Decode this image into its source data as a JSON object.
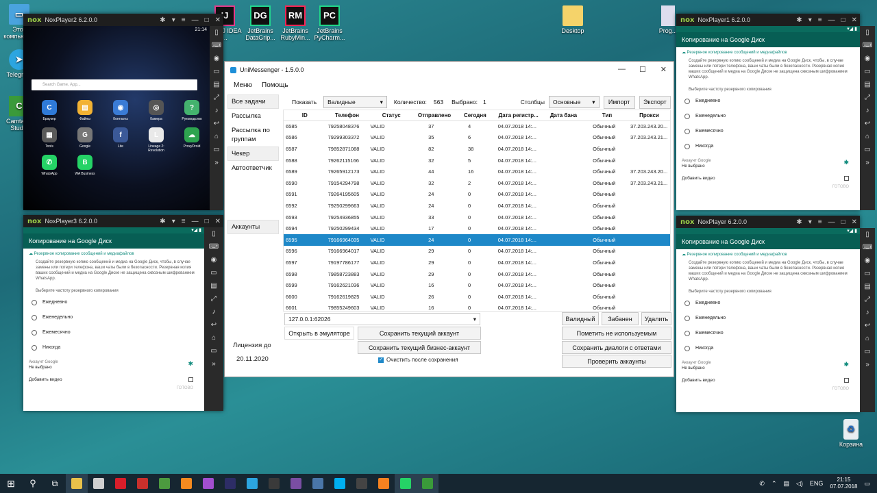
{
  "desktop": {
    "icons_top": [
      {
        "label": "IntelliJ IDEA ...",
        "abbr": "IJ",
        "color": "#111111"
      },
      {
        "label": "JetBrains DataGrip...",
        "abbr": "DG",
        "color": "#111111"
      },
      {
        "label": "JetBrains RubyMin...",
        "abbr": "RM",
        "color": "#111111"
      },
      {
        "label": "JetBrains PyCharm...",
        "abbr": "PC",
        "color": "#111111"
      }
    ],
    "left_icons": [
      {
        "label": "Этот компьютер"
      },
      {
        "label": "Telegram"
      },
      {
        "label": "Camtasia Studio"
      }
    ],
    "desktop_folder": "Desktop",
    "recycle_bin": "Корзина",
    "prog_icon": "Prog..."
  },
  "nox2": {
    "title": "NoxPlayer2 6.2.0.0",
    "time": "21:14",
    "search_placeholder": "Search Game, App...",
    "apps": [
      {
        "label": "Браузер",
        "color": "#2f7ad8",
        "glyph": "C"
      },
      {
        "label": "Файлы",
        "color": "#f2b233",
        "glyph": "▤"
      },
      {
        "label": "Контакты",
        "color": "#3a7bd5",
        "glyph": "◉"
      },
      {
        "label": "Камера",
        "color": "#555555",
        "glyph": "◎"
      },
      {
        "label": "Руководство",
        "color": "#44b26e",
        "glyph": "?"
      },
      {
        "label": "Tools",
        "color": "#5a5a5a",
        "glyph": "▦"
      },
      {
        "label": "Google",
        "color": "#777777",
        "glyph": "G"
      },
      {
        "label": "Lite",
        "color": "#3b5998",
        "glyph": "f"
      },
      {
        "label": "Lineage 2: Revolution",
        "color": "#e9e9e9",
        "glyph": "L"
      },
      {
        "label": "ProxyDroid",
        "color": "#2ea44f",
        "glyph": "☁"
      },
      {
        "label": "WhatsApp",
        "color": "#25d366",
        "glyph": "✆"
      },
      {
        "label": "WA Business",
        "color": "#25d366",
        "glyph": "B"
      }
    ]
  },
  "backup_dialog": {
    "header": "Копирование на Google Диск",
    "section": "Резервное копирование сообщений и медиафайлов",
    "description": "Создайте резервную копию сообщений и медиа на Google Диск, чтобы, в случае замены или потери телефона, ваши чаты были в безопасности. Резервная копия ваших сообщений и медиа на Google Диске не защищена сквозным шифрованием WhatsApp.",
    "frequency_label": "Выберите частоту резервного копирования",
    "options": [
      "Ежедневно",
      "Еженедельно",
      "Ежемесячно",
      "Никогда"
    ],
    "account_label": "Аккаунт Google",
    "account_value": "Не выбрано",
    "add_video": "Добавить видео",
    "done": "ГОТОВО"
  },
  "nox3": {
    "title": "NoxPlayer3 6.2.0.0",
    "time": "21:14"
  },
  "nox1": {
    "title": "NoxPlayer1 6.2.0.0",
    "time": "21:15"
  },
  "nox0": {
    "title": "NoxPlayer 6.2.0.0",
    "time": "21:15"
  },
  "main": {
    "title": "UniMessenger - 1.5.0.0",
    "menu": [
      "Меню",
      "Помощь"
    ],
    "nav": [
      "Все задачи",
      "Рассылка",
      "Рассылка по группам",
      "Чекер",
      "Автоответчик"
    ],
    "nav_accounts": "Аккаунты",
    "toolbar": {
      "show_label": "Показать",
      "show_value": "Валидные",
      "count_label": "Количество:",
      "count_value": "563",
      "selected_label": "Выбрано:",
      "selected_value": "1",
      "columns_label": "Столбцы",
      "columns_value": "Основные",
      "import": "Импорт",
      "export": "Экспорт"
    },
    "columns": [
      "ID",
      "Телефон",
      "Статус",
      "Отправлено",
      "Сегодня",
      "Дата регистр...",
      "Дата бана",
      "Тип",
      "Прокси"
    ],
    "rows": [
      [
        "6585",
        "79258048376",
        "VALID",
        "37",
        "4",
        "04.07.2018 14:...",
        "",
        "Обычный",
        "37.203.243.20..."
      ],
      [
        "6586",
        "79299303372",
        "VALID",
        "35",
        "6",
        "04.07.2018 14:...",
        "",
        "Обычный",
        "37.203.243.21..."
      ],
      [
        "6587",
        "79852871088",
        "VALID",
        "82",
        "38",
        "04.07.2018 14:...",
        "",
        "Обычный",
        ""
      ],
      [
        "6588",
        "79262115166",
        "VALID",
        "32",
        "5",
        "04.07.2018 14:...",
        "",
        "Обычный",
        ""
      ],
      [
        "6589",
        "79265912173",
        "VALID",
        "44",
        "16",
        "04.07.2018 14:...",
        "",
        "Обычный",
        "37.203.243.20..."
      ],
      [
        "6590",
        "79154294798",
        "VALID",
        "32",
        "2",
        "04.07.2018 14:...",
        "",
        "Обычный",
        "37.203.243.21..."
      ],
      [
        "6591",
        "79264195605",
        "VALID",
        "24",
        "0",
        "04.07.2018 14:...",
        "",
        "Обычный",
        ""
      ],
      [
        "6592",
        "79250299663",
        "VALID",
        "24",
        "0",
        "04.07.2018 14:...",
        "",
        "Обычный",
        ""
      ],
      [
        "6593",
        "79254936855",
        "VALID",
        "33",
        "0",
        "04.07.2018 14:...",
        "",
        "Обычный",
        ""
      ],
      [
        "6594",
        "79250299434",
        "VALID",
        "17",
        "0",
        "04.07.2018 14:...",
        "",
        "Обычный",
        ""
      ],
      [
        "6595",
        "79166964035",
        "VALID",
        "24",
        "0",
        "04.07.2018 14:...",
        "",
        "Обычный",
        ""
      ],
      [
        "6596",
        "79166964017",
        "VALID",
        "29",
        "0",
        "04.07.2018 14:...",
        "",
        "Обычный",
        ""
      ],
      [
        "6597",
        "79197786177",
        "VALID",
        "29",
        "0",
        "04.07.2018 14:...",
        "",
        "Обычный",
        ""
      ],
      [
        "6598",
        "79858723883",
        "VALID",
        "29",
        "0",
        "04.07.2018 14:...",
        "",
        "Обычный",
        ""
      ],
      [
        "6599",
        "79162621036",
        "VALID",
        "16",
        "0",
        "04.07.2018 14:...",
        "",
        "Обычный",
        ""
      ],
      [
        "6600",
        "79162619825",
        "VALID",
        "26",
        "0",
        "04.07.2018 14:...",
        "",
        "Обычный",
        ""
      ],
      [
        "6601",
        "79855249603",
        "VALID",
        "16",
        "0",
        "04.07.2018 14:...",
        "",
        "Обычный",
        ""
      ]
    ],
    "selected_row": "6595",
    "emulator_value": "127.0.0.1:62026",
    "open_in_emulator": "Открыть в эмуляторе",
    "save_account": "Сохранить текущий аккаунт",
    "save_business": "Сохранить текущий бизнес-аккаунт",
    "clear_after_save": "Очистить после сохранения",
    "license_label": "Лицензия до",
    "license_date": "20.11.2020",
    "valid_btn": "Валидный",
    "banned_btn": "Забанен",
    "delete_btn": "Удалить",
    "mark_unused": "Пометить не используемым",
    "save_dialogs": "Сохранить диалоги с ответами",
    "check_accounts": "Проверить аккаунты"
  },
  "taskbar": {
    "tray_lang": "ENG",
    "time": "21:15",
    "date": "07.07.2018",
    "apps": [
      {
        "name": "explorer",
        "color": "#e8c14a"
      },
      {
        "name": "chrome-like",
        "color": "#cfcfcf"
      },
      {
        "name": "opera",
        "color": "#d81e2a"
      },
      {
        "name": "dc",
        "color": "#c9302c"
      },
      {
        "name": "sheet",
        "color": "#4c9a3f"
      },
      {
        "name": "sublime",
        "color": "#f48a1f"
      },
      {
        "name": "datagrip",
        "color": "#a24fd0"
      },
      {
        "name": "intellij",
        "color": "#2d2d66"
      },
      {
        "name": "telegram",
        "color": "#2ca5e0"
      },
      {
        "name": "steam",
        "color": "#3a3a3a"
      },
      {
        "name": "tor",
        "color": "#7a4ea3"
      },
      {
        "name": "vk",
        "color": "#4a76a8"
      },
      {
        "name": "skype",
        "color": "#00aff0"
      },
      {
        "name": "nox",
        "color": "#444444"
      },
      {
        "name": "ok",
        "color": "#f58220"
      },
      {
        "name": "whatsapp",
        "color": "#25d366"
      },
      {
        "name": "camtasia",
        "color": "#3a9a3a"
      }
    ]
  }
}
